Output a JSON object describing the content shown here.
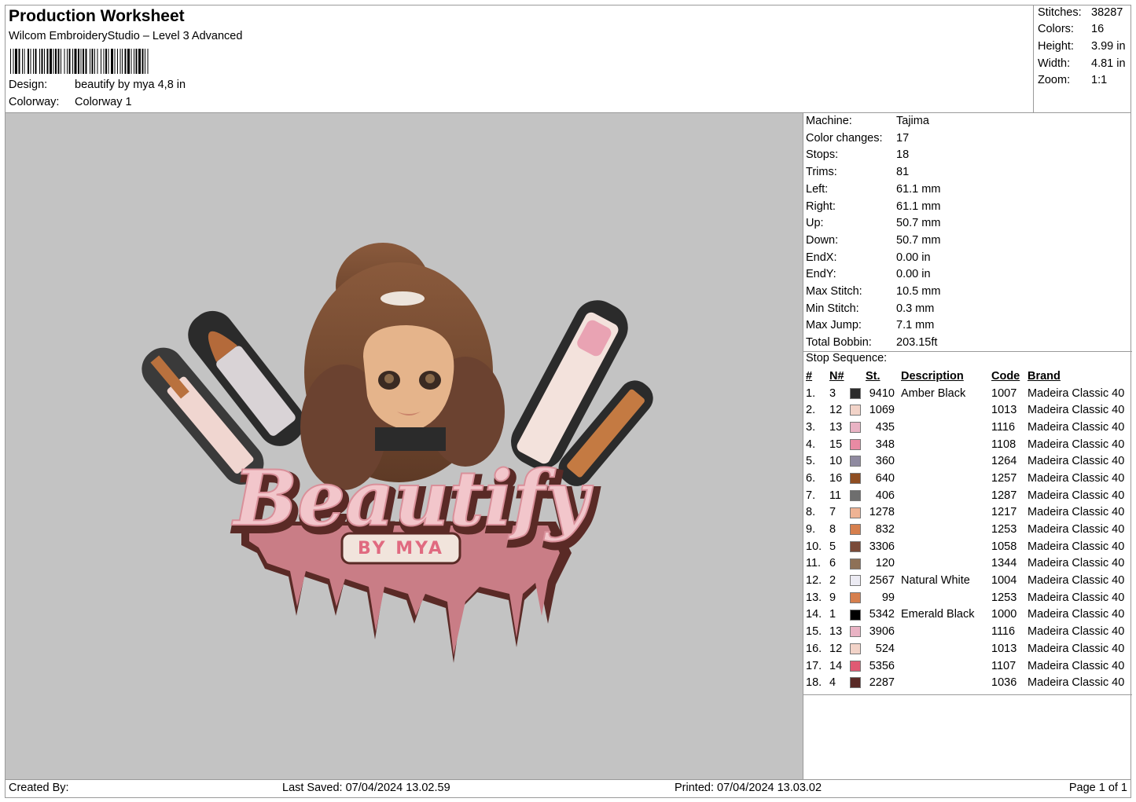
{
  "header": {
    "title": "Production Worksheet",
    "software": "Wilcom EmbroideryStudio – Level 3 Advanced",
    "design_label": "Design:",
    "design_value": "beautify by mya 4,8 in",
    "colorway_label": "Colorway:",
    "colorway_value": "Colorway 1"
  },
  "stats": [
    {
      "label": "Stitches:",
      "value": "38287"
    },
    {
      "label": "Colors:",
      "value": "16"
    },
    {
      "label": "Height:",
      "value": "3.99 in"
    },
    {
      "label": "Width:",
      "value": "4.81 in"
    },
    {
      "label": "Zoom:",
      "value": "1:1"
    }
  ],
  "machine": [
    {
      "label": "Machine:",
      "value": "Tajima"
    },
    {
      "label": "Color changes:",
      "value": "17"
    },
    {
      "label": "Stops:",
      "value": "18"
    },
    {
      "label": "Trims:",
      "value": "81"
    },
    {
      "label": "Left:",
      "value": "61.1 mm"
    },
    {
      "label": "Right:",
      "value": "61.1 mm"
    },
    {
      "label": "Up:",
      "value": "50.7 mm"
    },
    {
      "label": "Down:",
      "value": "50.7 mm"
    },
    {
      "label": "EndX:",
      "value": "0.00 in"
    },
    {
      "label": "EndY:",
      "value": "0.00 in"
    },
    {
      "label": "Max Stitch:",
      "value": "10.5 mm"
    },
    {
      "label": "Min Stitch:",
      "value": "0.3 mm"
    },
    {
      "label": "Max Jump:",
      "value": "7.1 mm"
    },
    {
      "label": "Total Bobbin:",
      "value": "203.15ft"
    }
  ],
  "stop_sequence": {
    "title": "Stop Sequence:",
    "columns": [
      "#",
      "N#",
      "St.",
      "Description",
      "Code",
      "Brand"
    ],
    "rows": [
      {
        "idx": "1.",
        "n": "3",
        "color": "#2b2b2b",
        "st": "9410",
        "desc": "Amber Black",
        "code": "1007",
        "brand": "Madeira Classic 40"
      },
      {
        "idx": "2.",
        "n": "12",
        "color": "#f2d3c8",
        "st": "1069",
        "desc": "",
        "code": "1013",
        "brand": "Madeira Classic 40"
      },
      {
        "idx": "3.",
        "n": "13",
        "color": "#e9b3c4",
        "st": "435",
        "desc": "",
        "code": "1116",
        "brand": "Madeira Classic 40"
      },
      {
        "idx": "4.",
        "n": "15",
        "color": "#e98aa3",
        "st": "348",
        "desc": "",
        "code": "1108",
        "brand": "Madeira Classic 40"
      },
      {
        "idx": "5.",
        "n": "10",
        "color": "#8f8aa0",
        "st": "360",
        "desc": "",
        "code": "1264",
        "brand": "Madeira Classic 40"
      },
      {
        "idx": "6.",
        "n": "16",
        "color": "#8f4e22",
        "st": "640",
        "desc": "",
        "code": "1257",
        "brand": "Madeira Classic 40"
      },
      {
        "idx": "7.",
        "n": "11",
        "color": "#6e6e6e",
        "st": "406",
        "desc": "",
        "code": "1287",
        "brand": "Madeira Classic 40"
      },
      {
        "idx": "8.",
        "n": "7",
        "color": "#efb394",
        "st": "1278",
        "desc": "",
        "code": "1217",
        "brand": "Madeira Classic 40"
      },
      {
        "idx": "9.",
        "n": "8",
        "color": "#d67f4d",
        "st": "832",
        "desc": "",
        "code": "1253",
        "brand": "Madeira Classic 40"
      },
      {
        "idx": "10.",
        "n": "5",
        "color": "#7a4a38",
        "st": "3306",
        "desc": "",
        "code": "1058",
        "brand": "Madeira Classic 40"
      },
      {
        "idx": "11.",
        "n": "6",
        "color": "#8e7157",
        "st": "120",
        "desc": "",
        "code": "1344",
        "brand": "Madeira Classic 40"
      },
      {
        "idx": "12.",
        "n": "2",
        "color": "#ecebf3",
        "st": "2567",
        "desc": "Natural White",
        "code": "1004",
        "brand": "Madeira Classic 40"
      },
      {
        "idx": "13.",
        "n": "9",
        "color": "#d67f4d",
        "st": "99",
        "desc": "",
        "code": "1253",
        "brand": "Madeira Classic 40"
      },
      {
        "idx": "14.",
        "n": "1",
        "color": "#000000",
        "st": "5342",
        "desc": "Emerald Black",
        "code": "1000",
        "brand": "Madeira Classic 40"
      },
      {
        "idx": "15.",
        "n": "13",
        "color": "#e9b3c4",
        "st": "3906",
        "desc": "",
        "code": "1116",
        "brand": "Madeira Classic 40"
      },
      {
        "idx": "16.",
        "n": "12",
        "color": "#f2d3c8",
        "st": "524",
        "desc": "",
        "code": "1013",
        "brand": "Madeira Classic 40"
      },
      {
        "idx": "17.",
        "n": "14",
        "color": "#e05a73",
        "st": "5356",
        "desc": "",
        "code": "1107",
        "brand": "Madeira Classic 40"
      },
      {
        "idx": "18.",
        "n": "4",
        "color": "#5a2a26",
        "st": "2287",
        "desc": "",
        "code": "1036",
        "brand": "Madeira Classic 40"
      }
    ]
  },
  "design_text": {
    "main": "Beautify",
    "sub": "BY MYA"
  },
  "footer": {
    "created_by": "Created By:",
    "last_saved": "Last Saved: 07/04/2024 13.02.59",
    "printed": "Printed: 07/04/2024 13.03.02",
    "page": "Page 1 of 1"
  }
}
